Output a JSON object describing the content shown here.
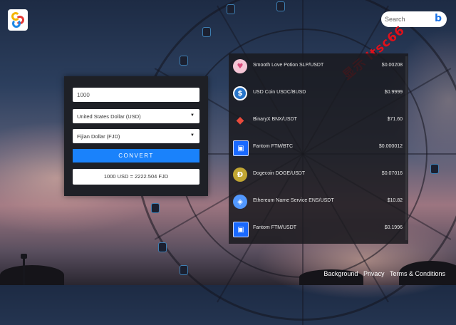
{
  "search": {
    "placeholder": "Search"
  },
  "watermark": "显示 ltsc66",
  "converter": {
    "amount": "1000",
    "from_currency": "United States Dollar (USD)",
    "to_currency": "Fijian Dollar (FJD)",
    "convert_label": "CONVERT",
    "result": "1000 USD = 2222.504 FJD"
  },
  "crypto": [
    {
      "name": "Smooth Love Potion SLP/USDT",
      "price": "$0.00208",
      "icon": "slp-potion-icon",
      "color": "#f5c6d6"
    },
    {
      "name": "USD Coin USDC/BUSD",
      "price": "$0.9999",
      "icon": "usdc-icon",
      "color": "#2775ca"
    },
    {
      "name": "BinaryX BNX/USDT",
      "price": "$71.60",
      "icon": "binaryx-icon",
      "color": "#e94b3c"
    },
    {
      "name": "Fantom FTM/BTC",
      "price": "$0.000012",
      "icon": "fantom-icon",
      "color": "#1969ff"
    },
    {
      "name": "Dogecoin DOGE/USDT",
      "price": "$0.07016",
      "icon": "dogecoin-icon",
      "color": "#c2a633"
    },
    {
      "name": "Ethereum Name Service ENS/USDT",
      "price": "$10.82",
      "icon": "ens-icon",
      "color": "#5298ff"
    },
    {
      "name": "Fantom FTM/USDT",
      "price": "$0.1996",
      "icon": "fantom-icon",
      "color": "#1969ff"
    }
  ],
  "footer": {
    "background": "Background",
    "privacy": "Privacy",
    "terms": "Terms & Conditions"
  }
}
